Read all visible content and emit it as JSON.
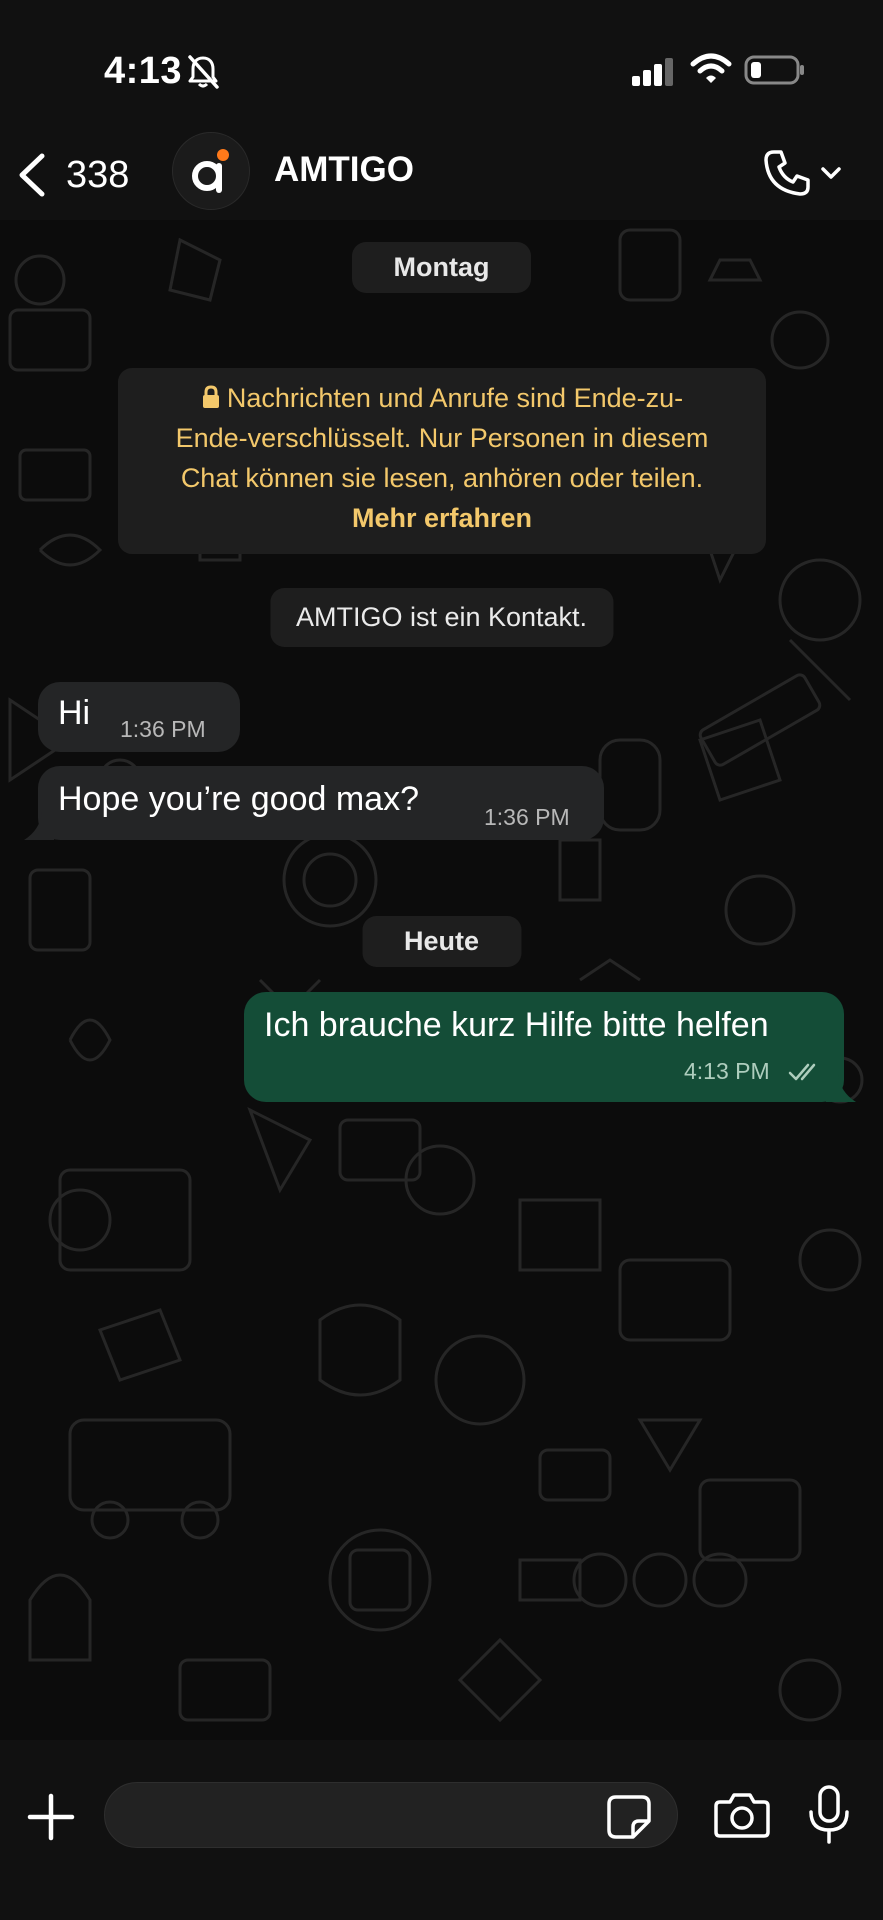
{
  "status_bar": {
    "time": "4:13",
    "icons": [
      "bell-slash-icon",
      "cellular-signal-icon",
      "wifi-icon",
      "battery-low-icon"
    ]
  },
  "header": {
    "back_count": "338",
    "contact_name": "AMTIGO",
    "avatar_letter": "a",
    "avatar_accent": "#ff7a1a",
    "icons": [
      "back-chevron-icon",
      "phone-icon",
      "chevron-down-icon"
    ]
  },
  "chat": {
    "date_montag": "Montag",
    "e2e_notice": "Nachrichten und Anrufe sind Ende-zu-Ende-verschlüsselt. Nur Personen in diesem Chat können sie lesen, anhören oder teilen.",
    "e2e_notice_lines": [
      "Nachrichten und Anrufe sind Ende-zu-",
      "Ende-verschlüsselt. Nur Personen in diesem",
      "Chat können sie lesen, anhören oder teilen."
    ],
    "e2e_link": "Mehr erfahren",
    "system_message": "AMTIGO ist ein Kontakt.",
    "messages": [
      {
        "direction": "incoming",
        "text": "Hi",
        "time": "1:36 PM"
      },
      {
        "direction": "incoming",
        "text": "Hope you’re good max?",
        "time": "1:36 PM"
      },
      {
        "direction": "outgoing",
        "text": "Ich brauche kurz Hilfe bitte helfen",
        "time": "4:13 PM",
        "status": "read-double-check"
      }
    ],
    "date_heute": "Heute"
  },
  "input_bar": {
    "placeholder": "",
    "icons": [
      "plus-icon",
      "sticker-icon",
      "camera-icon",
      "microphone-icon"
    ]
  },
  "colors": {
    "background": "#0b0b0b",
    "bar": "#111111",
    "incoming_bubble": "#242526",
    "outgoing_bubble": "#144d37",
    "e2e_text": "#f3c86b"
  }
}
